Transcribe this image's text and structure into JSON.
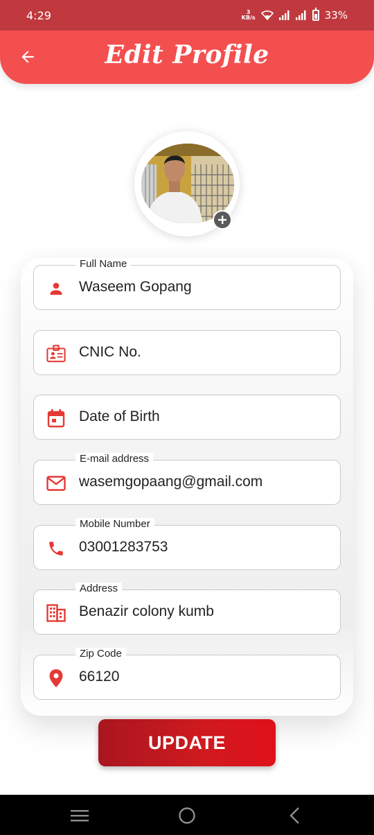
{
  "status_bar": {
    "time": "4:29",
    "net_speed_value": "3",
    "net_speed_unit": "KB/s",
    "battery": "33%"
  },
  "app_bar": {
    "title": "Edit Profile"
  },
  "form": {
    "fields": [
      {
        "label": "Full Name",
        "value": "Waseem Gopang",
        "icon": "person-icon"
      },
      {
        "label": "",
        "value": "CNIC No.",
        "icon": "id-card-icon"
      },
      {
        "label": "",
        "value": "Date of Birth",
        "icon": "calendar-icon"
      },
      {
        "label": "E-mail address",
        "value": "wasemgopaang@gmail.com",
        "icon": "mail-icon"
      },
      {
        "label": "Mobile Number",
        "value": "03001283753",
        "icon": "phone-icon"
      },
      {
        "label": "Address",
        "value": "Benazir colony kumb",
        "icon": "building-icon"
      },
      {
        "label": "Zip Code",
        "value": "66120",
        "icon": "location-pin-icon"
      }
    ]
  },
  "update_button": {
    "label": "UPDATE"
  },
  "colors": {
    "status_bar": "#c0393f",
    "app_bar": "#f44f4f",
    "icon_red": "#e53935",
    "button": "#d01a1f"
  }
}
